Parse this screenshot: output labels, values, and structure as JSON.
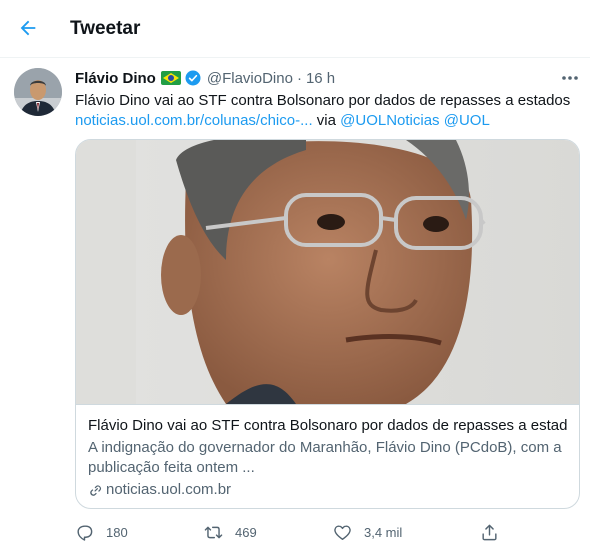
{
  "header": {
    "title": "Tweetar"
  },
  "tweet": {
    "author_name": "Flávio Dino",
    "author_flag": "🇧🇷",
    "handle": "@FlavioDino",
    "separator": "·",
    "time": "16 h",
    "text": "Flávio Dino vai ao STF contra Bolsonaro por dados de repasses a estados",
    "link": "noticias.uol.com.br/colunas/chico-...",
    "via_label": "via",
    "mention_1": "@UOLNoticias",
    "mention_2": "@UOL"
  },
  "card": {
    "title": "Flávio Dino vai ao STF contra Bolsonaro por dados de repasses a estad...",
    "description": "A indignação do governador do Maranhão, Flávio Dino (PCdoB), com a publicação feita ontem ...",
    "domain": "noticias.uol.com.br"
  },
  "actions": {
    "replies": "180",
    "retweets": "469",
    "likes": "3,4 mil"
  },
  "colors": {
    "accent": "#1d9bf0",
    "text_primary": "#0f1419",
    "text_secondary": "#536471",
    "border": "#cfd9de"
  },
  "icons": {
    "back": "arrow-left-icon",
    "verified": "verified-badge-icon",
    "more": "more-dots-icon",
    "reply": "reply-icon",
    "retweet": "retweet-icon",
    "like": "heart-icon",
    "share": "share-icon",
    "link": "link-icon"
  }
}
